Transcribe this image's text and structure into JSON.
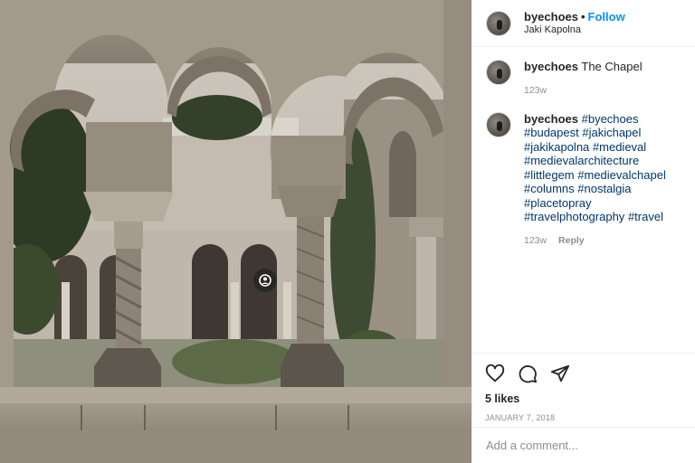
{
  "post": {
    "username": "byechoes",
    "separator": "•",
    "follow_label": "Follow",
    "location": "Jaki Kapolna"
  },
  "photo": {
    "tagged_people_icon": "user-tag-icon"
  },
  "comments": [
    {
      "username": "byechoes",
      "text": "The Chapel",
      "time": "123w",
      "reply_label": ""
    },
    {
      "username": "byechoes",
      "hashtags": [
        "#byechoes",
        "#budapest",
        "#jakichapel",
        "#jakikapolna",
        "#medieval",
        "#medievalarchitecture",
        "#littlegem",
        "#medievalchapel",
        "#columns",
        "#nostalgia",
        "#placetopray",
        "#travelphotography",
        "#travel"
      ],
      "time": "123w",
      "reply_label": "Reply"
    }
  ],
  "actions": {
    "icons": [
      "heart-icon",
      "comment-icon",
      "share-icon"
    ],
    "likes": "5 likes",
    "date": "JANUARY 7, 2018"
  },
  "add_comment": {
    "placeholder": "Add a comment..."
  }
}
